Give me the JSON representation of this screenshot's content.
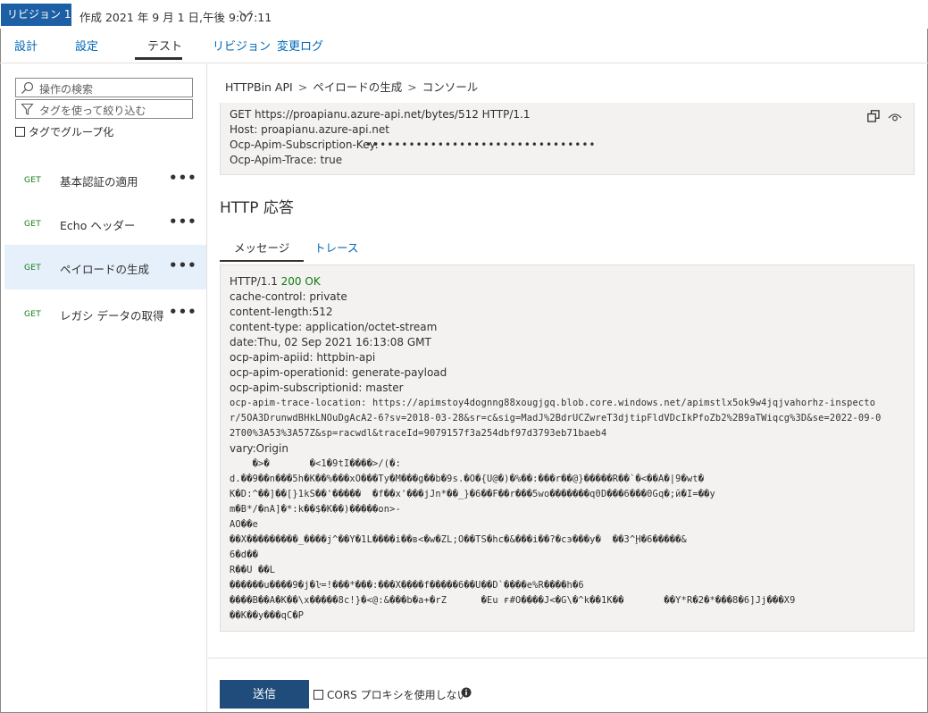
{
  "revision": {
    "badge": "リビジョン 1",
    "created": "作成 2021 年 9 月 1 日,午後 9:07:11"
  },
  "tabs": [
    {
      "label": "設計"
    },
    {
      "label": "設定"
    },
    {
      "label": "テスト"
    },
    {
      "label": "リビジョン"
    },
    {
      "label": "変更ログ"
    }
  ],
  "left": {
    "search_placeholder": "操作の検索",
    "filter_placeholder": "タグを使って絞り込む",
    "group_by_tag": "タグでグループ化",
    "operations": [
      {
        "verb": "GET",
        "name": "基本認証の適用"
      },
      {
        "verb": "GET",
        "name": "Echo ヘッダー"
      },
      {
        "verb": "GET",
        "name": "ペイロードの生成"
      },
      {
        "verb": "GET",
        "name": "レガシ データの取得"
      }
    ],
    "more": "•••"
  },
  "breadcrumb": {
    "api": "HTTPBin API",
    "operation": "ペイロードの生成",
    "page": "コンソール",
    "sep": ">"
  },
  "request": {
    "line1": "GET https://proapianu.azure-api.net/bytes/512 HTTP/1.1",
    "host": "Host: proapianu.azure-api.net",
    "sub_key_label": "Ocp-Apim-Subscription-Key:",
    "sub_key_value": "••••••••••••••••••••••••••••••••",
    "trace": "Ocp-Apim-Trace: true"
  },
  "response": {
    "title": "HTTP 応答",
    "tab_message": "メッセージ",
    "tab_trace": "トレース",
    "status_proto": "HTTP/1.1 ",
    "status_ok": "200 OK",
    "headers": [
      "cache-control: private",
      "content-length:512",
      "content-type: application/octet-stream",
      "date:Thu, 02 Sep 2021 16:13:08 GMT",
      "ocp-apim-apiid: httpbin-api",
      "ocp-apim-operationid: generate-payload",
      "ocp-apim-subscriptionid: master"
    ],
    "trace_location": [
      "ocp-apim-trace-location: https://apimstoy4dognng88xougjgq.blob.core.windows.net/apimstlx5ok9w4jqjvahorhz-inspecto",
      "r/5OA3DrunwdBHkLNOuDgAcA2-6?sv=2018-03-28&sr=c&sig=MadJ%2BdrUCZwreT3djtipFldVDcIkPfoZb2%2B9aTWiqcg%3D&se=2022-09-0",
      "2T00%3A53%3A57Z&sp=racwdl&traceId=9079157f3a254dbf97d3793eb71baeb4"
    ],
    "vary": "vary:Origin",
    "body": [
      "    �>�       �<1�9tI����>/(�:",
      "d.��9��n���5h�K��%���xO���Ty�M���g��b�9s.�O�{U@�)�%��:���r��@}�����R��`�<��A�|9�wt�",
      "K�D:^��]��[}1kS��'�����  �f��x'���jJn*��_}�6��F��r���5wo�������q0D���6���0Gq�;й�I=��y",
      "m�B*/�nA]�*:k��$�K��)�����on>-",
      "AO��e",
      "��X���������_����j^��Y�1L����i��в<�w�ZL;O��TS�hc�&���i��?�сэ���y�  ��3^Ḩ�6�����&",
      "6�d��",
      "R��U ��L",
      "������u����9�j�ŀ=!���*���:���X����f�����6��U��D`����e%R����h�6",
      "����B��A�K��\\x�����8c!}�<@:&���b�a+�rZ      �Eu ғ#O����J<�G\\�^k��1K��       ��Y*R�2�*���8�6]Jj���X9",
      "��K��y���qC�P"
    ]
  },
  "footer": {
    "send": "送信",
    "cors": "CORS プロキシを使用しない"
  },
  "colors": {
    "accent": "#0068b8",
    "badge": "#1d5fa5",
    "send": "#1f4c7a",
    "ok": "#107c10"
  }
}
